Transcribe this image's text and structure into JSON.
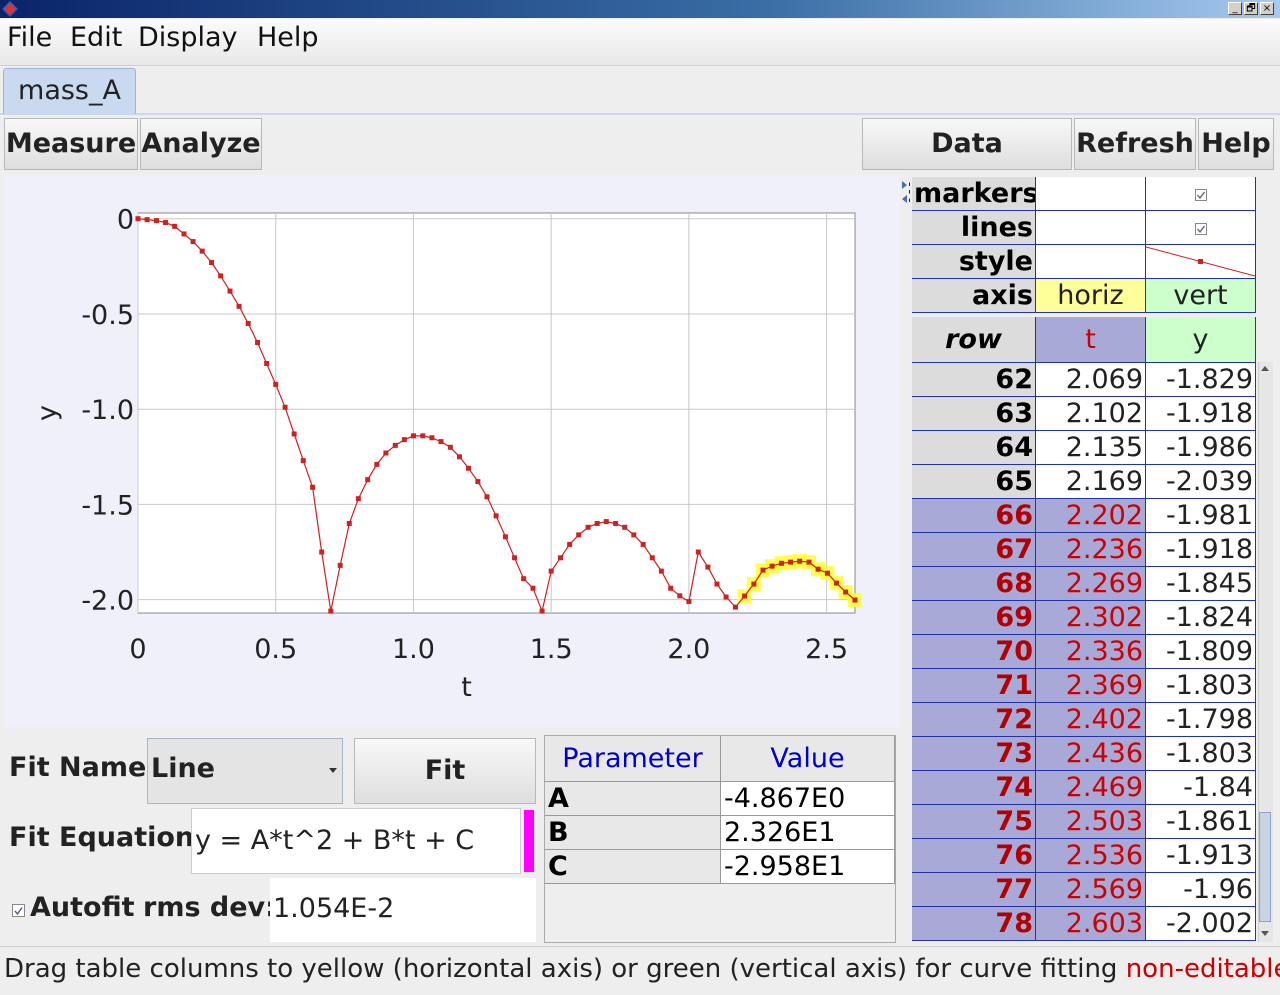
{
  "window": {
    "minimize": "_",
    "restore": "🗗",
    "close": "×"
  },
  "menu": [
    "File",
    "Edit",
    "Display",
    "Help"
  ],
  "tab": "mass_A",
  "toolbar": {
    "measure": "Measure",
    "analyze": "Analyze",
    "data_builder": "Data Builder...",
    "refresh": "Refresh",
    "help": "Help"
  },
  "chart_data": {
    "type": "scatter",
    "xlabel": "t",
    "ylabel": "y",
    "xlim": [
      0,
      2.603
    ],
    "ylim": [
      -2.07,
      0.03
    ],
    "xticks": [
      "0",
      "0.5",
      "1.0",
      "1.5",
      "2.0",
      "2.5"
    ],
    "xtick_values": [
      0,
      0.5,
      1.0,
      1.5,
      2.0,
      2.5
    ],
    "yticks": [
      "0",
      "-0.5",
      "-1.0",
      "-1.5",
      "-2.0"
    ],
    "ytick_values": [
      0,
      -0.5,
      -1.0,
      -1.5,
      -2.0
    ],
    "grid": true,
    "series_color": "#d02020",
    "highlight_color": "#ffff33",
    "t": [
      0.0,
      0.033,
      0.067,
      0.1,
      0.133,
      0.167,
      0.2,
      0.233,
      0.267,
      0.3,
      0.334,
      0.367,
      0.4,
      0.434,
      0.467,
      0.5,
      0.534,
      0.567,
      0.6,
      0.634,
      0.667,
      0.7,
      0.734,
      0.767,
      0.8,
      0.834,
      0.867,
      0.9,
      0.934,
      0.967,
      1.0,
      1.034,
      1.067,
      1.1,
      1.134,
      1.167,
      1.2,
      1.234,
      1.267,
      1.3,
      1.334,
      1.367,
      1.4,
      1.434,
      1.467,
      1.5,
      1.534,
      1.567,
      1.6,
      1.634,
      1.667,
      1.7,
      1.734,
      1.767,
      1.8,
      1.834,
      1.867,
      1.9,
      1.934,
      1.967,
      2.0,
      2.034,
      2.069,
      2.102,
      2.135,
      2.169,
      2.202,
      2.236,
      2.269,
      2.302,
      2.336,
      2.369,
      2.402,
      2.436,
      2.469,
      2.503,
      2.536,
      2.569,
      2.603
    ],
    "y": [
      0.0,
      -0.005,
      -0.01,
      -0.02,
      -0.04,
      -0.08,
      -0.12,
      -0.17,
      -0.23,
      -0.3,
      -0.38,
      -0.46,
      -0.55,
      -0.65,
      -0.76,
      -0.87,
      -0.99,
      -1.13,
      -1.27,
      -1.41,
      -1.75,
      -2.06,
      -1.82,
      -1.6,
      -1.47,
      -1.37,
      -1.29,
      -1.23,
      -1.19,
      -1.16,
      -1.14,
      -1.14,
      -1.15,
      -1.17,
      -1.2,
      -1.25,
      -1.31,
      -1.38,
      -1.46,
      -1.56,
      -1.67,
      -1.78,
      -1.89,
      -1.94,
      -2.06,
      -1.85,
      -1.78,
      -1.71,
      -1.66,
      -1.62,
      -1.6,
      -1.59,
      -1.6,
      -1.62,
      -1.66,
      -1.71,
      -1.78,
      -1.85,
      -1.94,
      -1.98,
      -2.01,
      -1.75,
      -1.829,
      -1.918,
      -1.986,
      -2.039,
      -1.981,
      -1.918,
      -1.845,
      -1.824,
      -1.809,
      -1.803,
      -1.798,
      -1.803,
      -1.84,
      -1.861,
      -1.913,
      -1.96,
      -2.002
    ],
    "highlight_from_index": 66
  },
  "track_table": {
    "props": [
      {
        "label": "markers"
      },
      {
        "label": "lines"
      },
      {
        "label": "style"
      },
      {
        "label": "axis",
        "horiz": "horiz",
        "vert": "vert"
      }
    ],
    "header": {
      "row": "row",
      "t": "t",
      "y": "y"
    },
    "rows": [
      {
        "row": "62",
        "t": "2.069",
        "y": "-1.829",
        "selected": false
      },
      {
        "row": "63",
        "t": "2.102",
        "y": "-1.918",
        "selected": false
      },
      {
        "row": "64",
        "t": "2.135",
        "y": "-1.986",
        "selected": false
      },
      {
        "row": "65",
        "t": "2.169",
        "y": "-2.039",
        "selected": false
      },
      {
        "row": "66",
        "t": "2.202",
        "y": "-1.981",
        "selected": true
      },
      {
        "row": "67",
        "t": "2.236",
        "y": "-1.918",
        "selected": true
      },
      {
        "row": "68",
        "t": "2.269",
        "y": "-1.845",
        "selected": true
      },
      {
        "row": "69",
        "t": "2.302",
        "y": "-1.824",
        "selected": true
      },
      {
        "row": "70",
        "t": "2.336",
        "y": "-1.809",
        "selected": true
      },
      {
        "row": "71",
        "t": "2.369",
        "y": "-1.803",
        "selected": true
      },
      {
        "row": "72",
        "t": "2.402",
        "y": "-1.798",
        "selected": true
      },
      {
        "row": "73",
        "t": "2.436",
        "y": "-1.803",
        "selected": true
      },
      {
        "row": "74",
        "t": "2.469",
        "y": "-1.84",
        "selected": true
      },
      {
        "row": "75",
        "t": "2.503",
        "y": "-1.861",
        "selected": true
      },
      {
        "row": "76",
        "t": "2.536",
        "y": "-1.913",
        "selected": true
      },
      {
        "row": "77",
        "t": "2.569",
        "y": "-1.96",
        "selected": true
      },
      {
        "row": "78",
        "t": "2.603",
        "y": "-2.002",
        "selected": true
      }
    ]
  },
  "fit": {
    "name_label": "Fit Name:",
    "name_value": "Line",
    "builder": "Fit Builder...",
    "equation_label": "Fit Equation:",
    "equation": "y = A*t^2 + B*t + C",
    "autofit": "Autofit",
    "rms_label": "rms dev:",
    "rms_value": "1.054E-2",
    "param_header": "Parameter",
    "value_header": "Value",
    "params": [
      {
        "name": "A",
        "value": "-4.867E0"
      },
      {
        "name": "B",
        "value": "2.326E1"
      },
      {
        "name": "C",
        "value": "-2.958E1"
      }
    ]
  },
  "status": {
    "hint": "Drag table columns to yellow (horizontal axis) or green (vertical axis) for curve fitting",
    "mode": "non-editable"
  }
}
